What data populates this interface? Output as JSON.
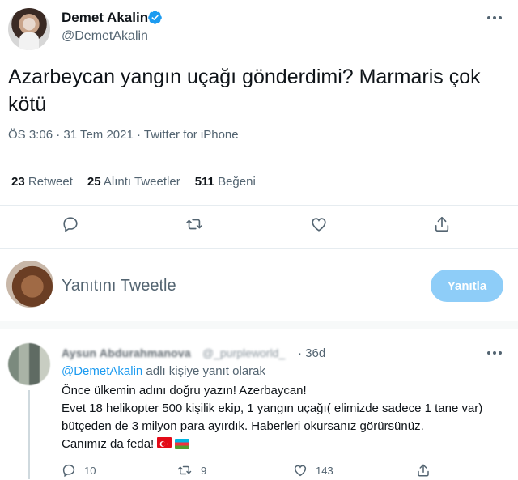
{
  "author": {
    "display_name": "Demet Akalin",
    "handle": "@DemetAkalin",
    "verified": true
  },
  "tweet": {
    "text": "Azarbeycan yangın uçağı gönderdimi? Marmaris çok kötü",
    "meta": "ÖS 3:06 · 31 Tem 2021 · Twitter for iPhone"
  },
  "stats": {
    "retweets_count": "23",
    "retweets_label": "Retweet",
    "quotes_count": "25",
    "quotes_label": "Alıntı Tweetler",
    "likes_count": "511",
    "likes_label": "Beğeni"
  },
  "compose": {
    "placeholder": "Yanıtını Tweetle",
    "button_label": "Yanıtla"
  },
  "reply": {
    "name": "Aysun Abdurahmanova",
    "handle": "@_purpleworld_",
    "time": "· 36d",
    "context_mention": "@DemetAkalin",
    "context_suffix": " adlı kişiye yanıt olarak",
    "line1": "Önce ülkemin adını doğru yazın! Azerbaycan!",
    "line2": "Evet 18 helikopter 500 kişilik ekip, 1 yangın uçağı( elimizde sadece 1 tane var) bütçeden de 3 milyon para ayırdık. Haberleri okursanız görürsünüz.",
    "line3": "Canımız da feda!",
    "reply_count": "10",
    "retweet_count": "9",
    "like_count": "143"
  },
  "colors": {
    "accent": "#1d9bf0",
    "reply_button_disabled": "#8ecdf8",
    "secondary_text": "#536471"
  },
  "icons": [
    "verified-badge-icon",
    "more-icon",
    "reply-icon",
    "retweet-icon",
    "like-icon",
    "share-icon",
    "turkey-flag-icon",
    "azerbaijan-flag-icon"
  ]
}
